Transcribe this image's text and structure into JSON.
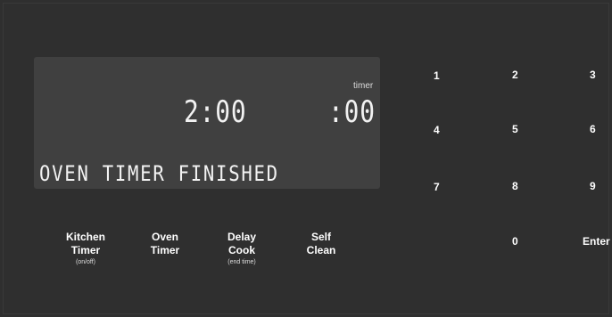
{
  "display": {
    "clock": "2:00",
    "timer_label": "timer",
    "timer": ":00",
    "message": "OVEN TIMER FINISHED"
  },
  "keypad": {
    "k1": "1",
    "k2": "2",
    "k3": "3",
    "k4": "4",
    "k5": "5",
    "k6": "6",
    "k7": "7",
    "k8": "8",
    "k9": "9",
    "k0": "0",
    "enter": "Enter"
  },
  "functions": {
    "kitchen_timer": {
      "line1": "Kitchen",
      "line2": "Timer",
      "sub": "(on/off)"
    },
    "oven_timer": {
      "line1": "Oven",
      "line2": "Timer"
    },
    "delay_cook": {
      "line1": "Delay",
      "line2": "Cook",
      "sub": "(end time)"
    },
    "self_clean": {
      "line1": "Self",
      "line2": "Clean"
    }
  },
  "colors": {
    "panel_background": "#2f2f2f",
    "display_background": "#404040",
    "text": "#ffffff"
  }
}
